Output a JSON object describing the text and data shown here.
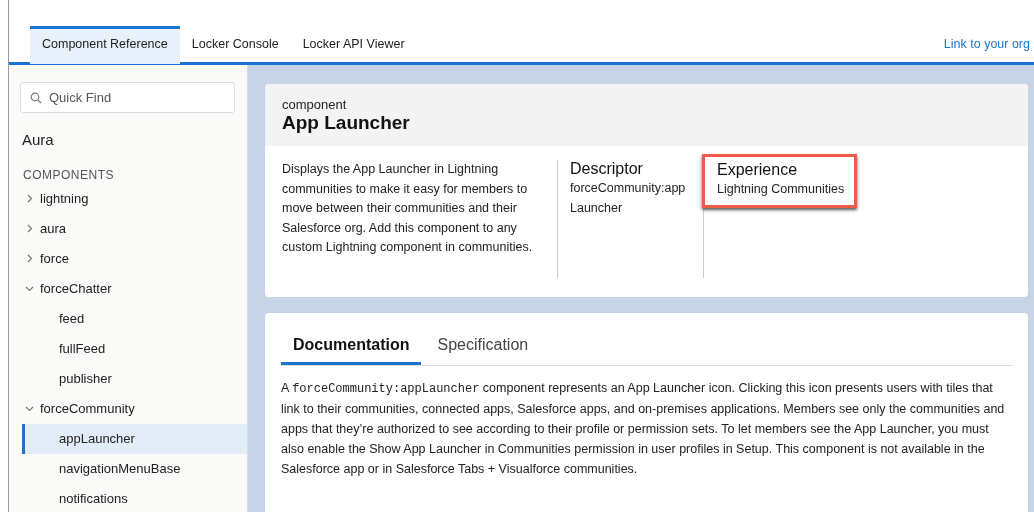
{
  "top_nav": {
    "tabs": [
      {
        "label": "Component Reference",
        "selected": true
      },
      {
        "label": "Locker Console",
        "selected": false
      },
      {
        "label": "Locker API Viewer",
        "selected": false
      }
    ],
    "link": "Link to your org"
  },
  "sidebar": {
    "search": {
      "placeholder": "Quick Find"
    },
    "heading": "Aura",
    "section": "COMPONENTS",
    "items": [
      {
        "label": "lightning",
        "expanded": false,
        "selected": false
      },
      {
        "label": "aura",
        "expanded": false,
        "selected": false
      },
      {
        "label": "force",
        "expanded": false,
        "selected": false
      },
      {
        "label": "forceChatter",
        "expanded": true,
        "selected": false,
        "children": [
          {
            "label": "feed",
            "selected": false
          },
          {
            "label": "fullFeed",
            "selected": false
          },
          {
            "label": "publisher",
            "selected": false
          }
        ]
      },
      {
        "label": "forceCommunity",
        "expanded": true,
        "selected": false,
        "children": [
          {
            "label": "appLauncher",
            "selected": true
          },
          {
            "label": "navigationMenuBase",
            "selected": false
          },
          {
            "label": "notifications",
            "selected": false
          }
        ]
      }
    ]
  },
  "header": {
    "kind_label": "component",
    "title": "App Launcher",
    "description": "Displays the App Launcher in Lightning communities to make it easy for members to move between their communities and their Salesforce org. Add this component to any custom Lightning component in communities.",
    "fields": [
      {
        "label": "Descriptor",
        "value": "forceCommunity:appLauncher",
        "highlighted": false
      },
      {
        "label": "Experience",
        "value": "Lightning Communities",
        "highlighted": true
      }
    ]
  },
  "doc": {
    "tabs": [
      {
        "label": "Documentation",
        "selected": true
      },
      {
        "label": "Specification",
        "selected": false
      }
    ],
    "paragraph": [
      {
        "kind": "text",
        "text": "A "
      },
      {
        "kind": "code",
        "text": "forceCommunity:appLauncher"
      },
      {
        "kind": "text",
        "text": " component represents an App Launcher icon. Clicking this icon presents users with tiles that link to their communities, connected apps, Salesforce apps, and on-premises applications. Members see only the communities and apps that they’re authorized to see according to their profile or permission sets. To let members see the App Launcher, you must also enable the Show App Launcher in Communities permission in user profiles in Setup. This component is not available in the Salesforce app or in Salesforce Tabs + Visualforce communities."
      }
    ]
  }
}
